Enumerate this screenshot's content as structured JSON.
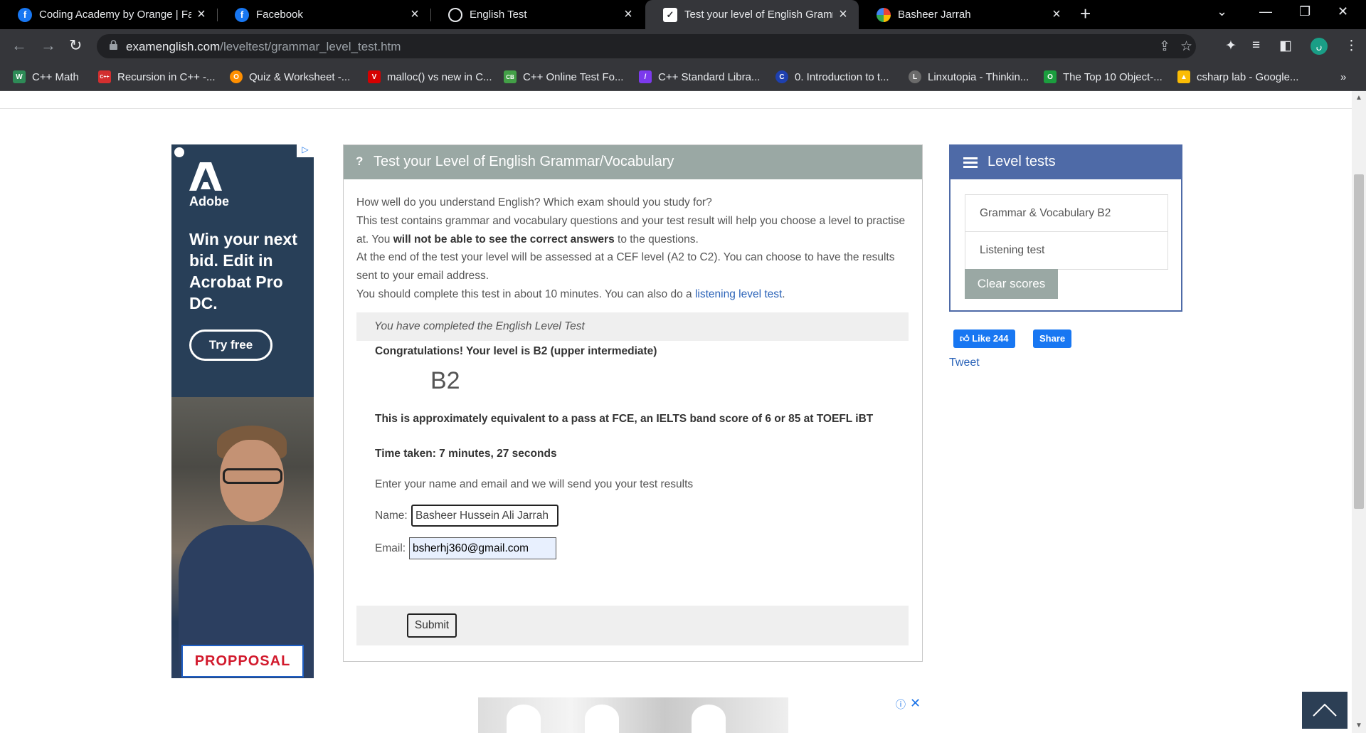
{
  "browser": {
    "tabs": [
      {
        "title": "Coding Academy by Orange | Fac",
        "icon": "facebook-icon",
        "color": "#1877f2"
      },
      {
        "title": "Facebook",
        "icon": "facebook-icon",
        "color": "#1877f2"
      },
      {
        "title": "English Test",
        "icon": "globe-icon",
        "color": "#5f6368"
      },
      {
        "title": "Test your level of English Gramm",
        "icon": "checkmark-icon",
        "color": "#ffffff"
      },
      {
        "title": "Basheer Jarrah",
        "icon": "google-photos-icon",
        "color": "#ea4335"
      }
    ],
    "url_host": "examenglish.com",
    "url_path": "/leveltest/grammar_level_test.htm",
    "profile_initial": "ں",
    "bookmarks": [
      {
        "label": "C++ Math",
        "color": "#2e8b57",
        "glyph": "W"
      },
      {
        "label": "Recursion in C++ -...",
        "color": "#d32f2f",
        "glyph": "C++"
      },
      {
        "label": "Quiz & Worksheet -...",
        "color": "#ff8f00",
        "glyph": "O"
      },
      {
        "label": "malloc() vs new in C...",
        "color": "#d50000",
        "glyph": "V"
      },
      {
        "label": "C++ Online Test Fo...",
        "color": "#43a047",
        "glyph": "CB"
      },
      {
        "label": "C++ Standard Libra...",
        "color": "#7c3aed",
        "glyph": "/"
      },
      {
        "label": "0. Introduction to t...",
        "color": "#1e40af",
        "glyph": "C"
      },
      {
        "label": "Linxutopia - Thinkin...",
        "color": "#6b6b6b",
        "glyph": "L"
      },
      {
        "label": "The Top 10 Object-...",
        "color": "#1b9e3e",
        "glyph": "O"
      },
      {
        "label": "csharp lab - Google...",
        "color": "#fbbc04",
        "glyph": "▲"
      }
    ]
  },
  "ad": {
    "brand": "Adobe",
    "headline": "Win your next bid. Edit in Acrobat Pro DC.",
    "cta": "Try free",
    "document_word": "PROPPOSAL"
  },
  "test": {
    "title": "Test your Level of English Grammar/Vocabulary",
    "intro_line1": "How well do you understand English? Which exam should you study for?",
    "intro_line2_a": "This test contains grammar and vocabulary questions and your test result will help you choose a level to practise at. You ",
    "intro_line2_bold": "will not be able to see the correct answers",
    "intro_line2_b": " to the questions.",
    "intro_line3": "At the end of the test your level will be assessed at a CEF level (A2 to C2). You can choose to have the results sent to your email address.",
    "intro_line4": "You should complete this test in about 10 minutes. You can also do a ",
    "listening_link": "listening level test",
    "completed": "You have completed the English Level Test",
    "congrats": "Congratulations! Your level is B2 (upper intermediate)",
    "level": "B2",
    "equivalent": "This is approximately equivalent to a pass at FCE, an IELTS band score of 6 or 85 at TOEFL iBT",
    "time_taken": "Time taken: 7 minutes, 27 seconds",
    "enter_prompt": "Enter your name and email and we will send you your test results",
    "name_label": "Name:",
    "name_value": "Basheer Hussein Ali Jarrah",
    "email_label": "Email:",
    "email_value": "bsherhj360@gmail.com",
    "submit_label": "Submit"
  },
  "sidebar": {
    "title": "Level tests",
    "items": [
      "Grammar & Vocabulary B2",
      "Listening test"
    ],
    "clear_label": "Clear scores",
    "like_label": "Like 244",
    "share_label": "Share",
    "tweet_label": "Tweet"
  },
  "bottom_ad": {
    "info": "ⓘ",
    "close": "✕"
  },
  "colors": {
    "header_gray": "#9aa8a4",
    "level_blue": "#4e6aa7",
    "link": "#2b63b8"
  }
}
